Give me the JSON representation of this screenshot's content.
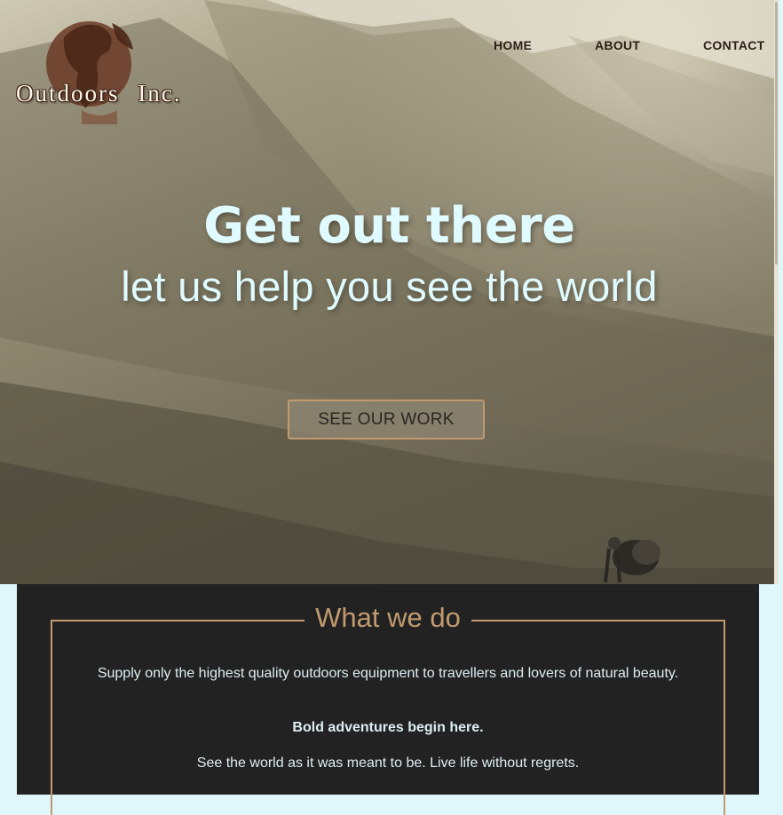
{
  "brand": {
    "name": "Outdoors Inc.",
    "logo_icon": "globe-icon"
  },
  "nav": {
    "items": [
      "HOME",
      "ABOUT",
      "CONTACT"
    ]
  },
  "hero": {
    "headline": "Get out there",
    "subheadline": "let us help you see the world",
    "cta_label": "SEE OUR WORK"
  },
  "section": {
    "title": "What we do",
    "paragraph1": "Supply only the highest quality outdoors equipment to travellers and lovers of natural beauty.",
    "paragraph2": "Bold adventures begin here.",
    "paragraph3": "See the world as it was meant to be. Live life without regrets."
  },
  "colors": {
    "accent": "#c19b6e",
    "hero_text": "#dffbff",
    "section_bg": "#232223",
    "page_bg": "#dff6fb",
    "nav_text": "#2b1f17"
  }
}
